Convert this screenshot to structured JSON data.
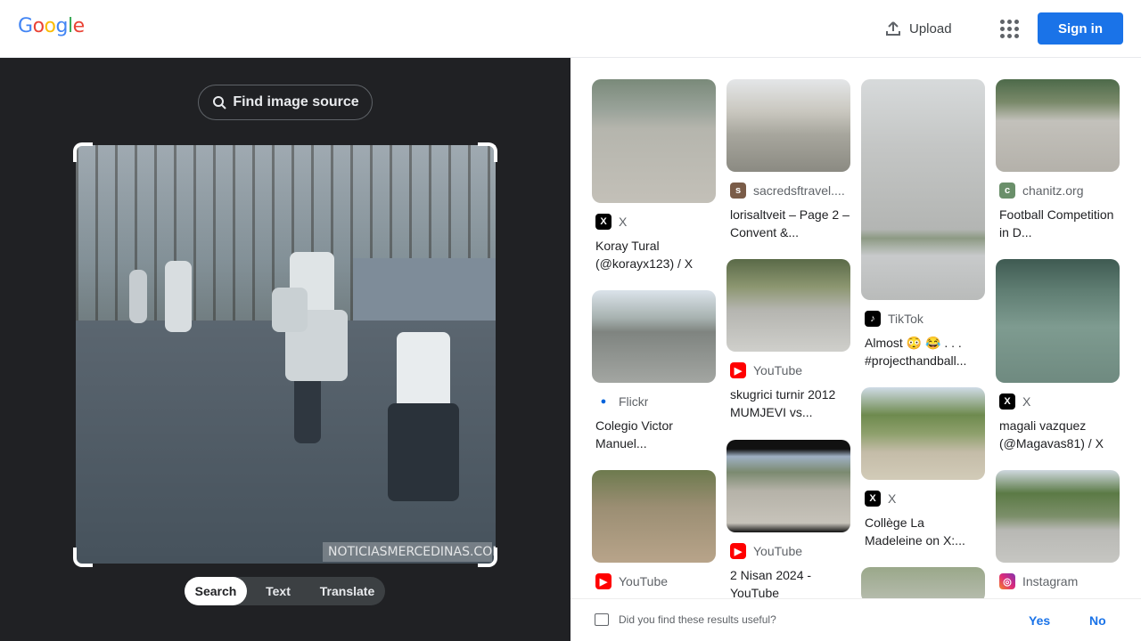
{
  "header": {
    "logo": {
      "l1": "G",
      "l2": "o",
      "l3": "o",
      "l4": "g",
      "l5": "l",
      "l6": "e"
    },
    "upload_label": "Upload",
    "signin_label": "Sign in"
  },
  "left": {
    "find_source_label": "Find image source",
    "watermark": "NOTICIASMERCEDINAS.COM",
    "modes": [
      "Search",
      "Text",
      "Translate"
    ],
    "active_mode": "Search"
  },
  "results": [
    {
      "source": "X",
      "icon": "x-icon",
      "title": "Koray Tural (@korayx123) / X"
    },
    {
      "source": "Flickr",
      "icon": "flickr-icon",
      "title": "Colegio Victor Manuel..."
    },
    {
      "source": "YouTube",
      "icon": "youtube-icon",
      "title": ""
    },
    {
      "source": "sacredsftravel....",
      "icon": "site-icon",
      "title": "lorisaltveit – Page 2 – Convent &..."
    },
    {
      "source": "YouTube",
      "icon": "youtube-icon",
      "title": "skugrici turnir 2012 MUMJEVI vs..."
    },
    {
      "source": "YouTube",
      "icon": "youtube-icon",
      "title": "2 Nisan 2024 - YouTube"
    },
    {
      "source": "TikTok",
      "icon": "tiktok-icon",
      "title": "Almost 😳 😂 . . . #projecthandball..."
    },
    {
      "source": "X",
      "icon": "x-icon",
      "title": "Collège La Madeleine on X:..."
    },
    {
      "source": "chanitz.org",
      "icon": "site-icon",
      "title": "Football Competition in D..."
    },
    {
      "source": "X",
      "icon": "x-icon",
      "title": "magali vazquez (@Magavas81) / X"
    },
    {
      "source": "Instagram",
      "icon": "instagram-icon",
      "title": ""
    }
  ],
  "feedback": {
    "question": "Did you find these results useful?",
    "yes": "Yes",
    "no": "No"
  },
  "colors": {
    "accent": "#1a73e8",
    "dark_panel": "#202124"
  }
}
